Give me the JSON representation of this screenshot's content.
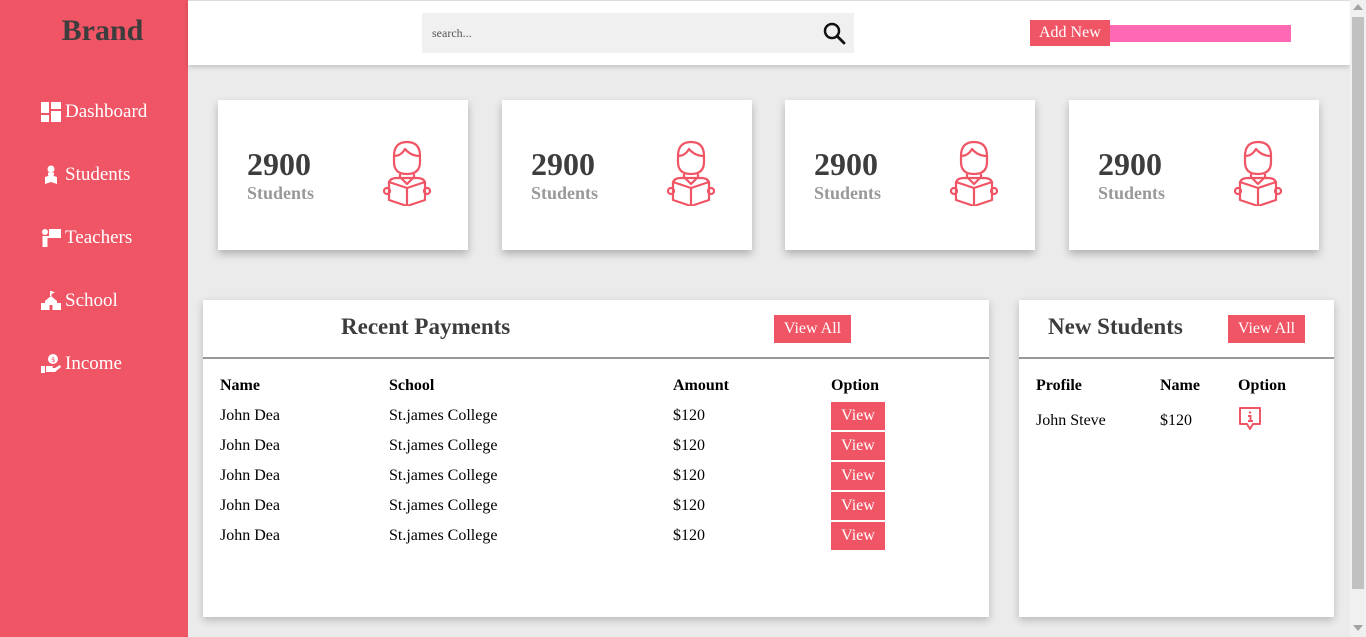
{
  "sidebar": {
    "brand": "Brand",
    "items": [
      {
        "label": "Dashboard",
        "icon": "dashboard-icon"
      },
      {
        "label": "Students",
        "icon": "student-icon"
      },
      {
        "label": "Teachers",
        "icon": "teacher-icon"
      },
      {
        "label": "School",
        "icon": "school-icon"
      },
      {
        "label": "Income",
        "icon": "income-icon"
      }
    ]
  },
  "header": {
    "search_placeholder": "search...",
    "search_icon": "search-icon",
    "add_new_label": "Add New"
  },
  "cards": [
    {
      "value": "2900",
      "label": "Students",
      "icon": "student-reading-icon"
    },
    {
      "value": "2900",
      "label": "Students",
      "icon": "student-reading-icon"
    },
    {
      "value": "2900",
      "label": "Students",
      "icon": "student-reading-icon"
    },
    {
      "value": "2900",
      "label": "Students",
      "icon": "student-reading-icon"
    }
  ],
  "recent_payments": {
    "title": "Recent Payments",
    "view_all_label": "View All",
    "columns": [
      "Name",
      "School",
      "Amount",
      "Option"
    ],
    "rows": [
      {
        "name": "John Dea",
        "school": "St.james College",
        "amount": "$120",
        "option": "View"
      },
      {
        "name": "John Dea",
        "school": "St.james College",
        "amount": "$120",
        "option": "View"
      },
      {
        "name": "John Dea",
        "school": "St.james College",
        "amount": "$120",
        "option": "View"
      },
      {
        "name": "John Dea",
        "school": "St.james College",
        "amount": "$120",
        "option": "View"
      },
      {
        "name": "John Dea",
        "school": "St.james College",
        "amount": "$120",
        "option": "View"
      }
    ]
  },
  "new_students": {
    "title": "New Students",
    "view_all_label": "View All",
    "columns": [
      "Profile",
      "Name",
      "Option"
    ],
    "rows": [
      {
        "profile": "John Steve",
        "name": "$120",
        "option_icon": "info-icon"
      }
    ]
  },
  "colors": {
    "accent": "#f05565",
    "pink_bar": "#ff69b4",
    "brand_text": "#3d3d3d"
  }
}
